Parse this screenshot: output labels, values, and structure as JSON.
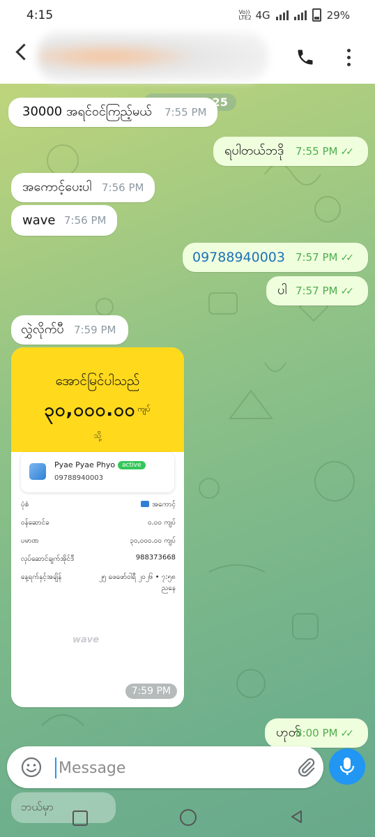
{
  "status_bar": {
    "time": "4:15",
    "network": "4G",
    "volte": "Vo)) LTE2",
    "battery": "29%"
  },
  "header": {
    "contact_name_blurred": true
  },
  "chat": {
    "date_label": "February 25",
    "messages": [
      {
        "text": "30000 အရင်ဝင်ကြည့်မယ်",
        "time": "7:55 PM",
        "dir": "in"
      },
      {
        "text": "ရပါတယ်ဘဒို",
        "time": "7:55 PM",
        "dir": "out"
      },
      {
        "text": "အကောင့်ပေးပါ",
        "time": "7:56 PM",
        "dir": "in"
      },
      {
        "text": "wave",
        "time": "7:56 PM",
        "dir": "in"
      },
      {
        "text": "09788940003",
        "time": "7:57 PM",
        "dir": "out"
      },
      {
        "text": "ပါ",
        "time": "7:57 PM",
        "dir": "out"
      },
      {
        "text": "လွှဲလိုက်ပီ",
        "time": "7:59 PM",
        "dir": "in"
      },
      {
        "text": "ဟုတ်",
        "time": "8:00 PM",
        "dir": "out"
      }
    ],
    "ticks": "✓✓"
  },
  "receipt": {
    "title": "အောင်မြင်ပါသည်",
    "amount": "၃၀,၀၀၀.၀၀",
    "amount_unit": "ကျပ်",
    "to_label": "သို့",
    "recipient_name": "Pyae Pyae Phyo",
    "recipient_status": "active",
    "recipient_phone": "09788940003",
    "rows": [
      {
        "label": "ပုံစံ",
        "value": "အကောင့်"
      },
      {
        "label": "ဝန်ဆောင်ခ",
        "value": "၀.၀၀ ကျပ်"
      },
      {
        "label": "ပမာဏ",
        "value": "၃၀,၀၀၀.၀၀ ကျပ်"
      },
      {
        "label": "လုပ်ဆောင်ချက်အိုင်ဒီ",
        "value": "988373668"
      },
      {
        "label": "နေ့ရက်နှင့်အချိန်",
        "value": "၂၅ ဖေဖော်ဝါရီ ၂၀၂၆ • ၇:၅၈"
      },
      {
        "label": "",
        "value": "ညနေ"
      }
    ],
    "brand": "wave",
    "time": "7:59 PM"
  },
  "composer": {
    "placeholder": "Message"
  },
  "ghost_preview": {
    "text": "ဘယ်မှာ"
  }
}
